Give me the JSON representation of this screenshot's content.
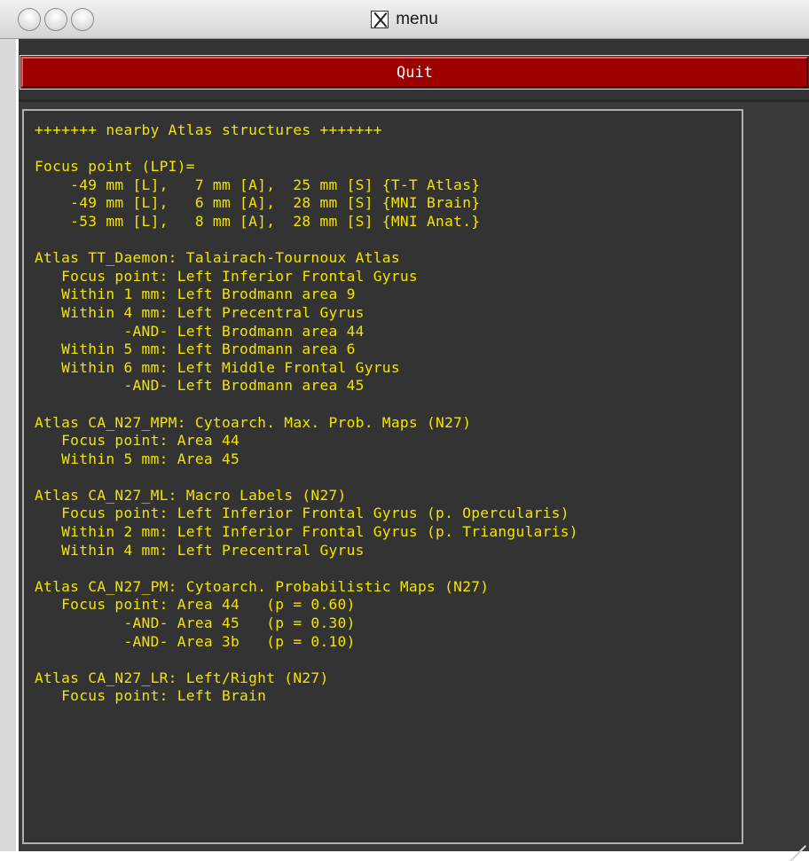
{
  "window": {
    "title": "menu",
    "title_icon": "x11-icon"
  },
  "toolbar": {
    "quit_label": "Quit"
  },
  "colors": {
    "text_yellow": "#f3e400",
    "quit_red": "#9c0000",
    "panel_bg": "#333333"
  },
  "atlas_output": {
    "text": "+++++++ nearby Atlas structures +++++++\n\nFocus point (LPI)=\n    -49 mm [L],   7 mm [A],  25 mm [S] {T-T Atlas}\n    -49 mm [L],   6 mm [A],  28 mm [S] {MNI Brain}\n    -53 mm [L],   8 mm [A],  28 mm [S] {MNI Anat.}\n\nAtlas TT_Daemon: Talairach-Tournoux Atlas\n   Focus point: Left Inferior Frontal Gyrus\n   Within 1 mm: Left Brodmann area 9\n   Within 4 mm: Left Precentral Gyrus\n          -AND- Left Brodmann area 44\n   Within 5 mm: Left Brodmann area 6\n   Within 6 mm: Left Middle Frontal Gyrus\n          -AND- Left Brodmann area 45\n\nAtlas CA_N27_MPM: Cytoarch. Max. Prob. Maps (N27)\n   Focus point: Area 44\n   Within 5 mm: Area 45\n\nAtlas CA_N27_ML: Macro Labels (N27)\n   Focus point: Left Inferior Frontal Gyrus (p. Opercularis)\n   Within 2 mm: Left Inferior Frontal Gyrus (p. Triangularis)\n   Within 4 mm: Left Precentral Gyrus\n\nAtlas CA_N27_PM: Cytoarch. Probabilistic Maps (N27)\n   Focus point: Area 44   (p = 0.60)\n          -AND- Area 45   (p = 0.30)\n          -AND- Area 3b   (p = 0.10)\n\nAtlas CA_N27_LR: Left/Right (N27)\n   Focus point: Left Brain"
  }
}
